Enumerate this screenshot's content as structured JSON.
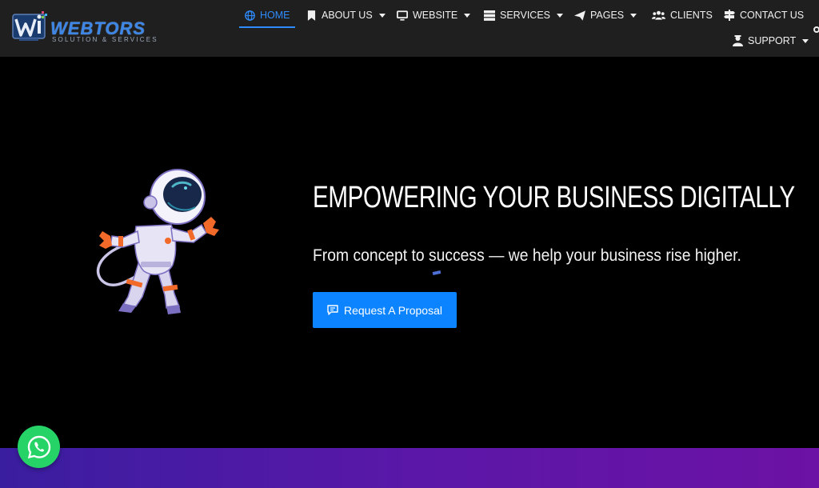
{
  "brand": {
    "name": "WEBTORS",
    "tagline": "SOLUTION & SERVICES",
    "accent": "#3d86e6"
  },
  "nav": {
    "items": [
      {
        "label": "HOME",
        "icon": "globe-icon",
        "dropdown": false,
        "active": true
      },
      {
        "label": "ABOUT US",
        "icon": "bookmark-icon",
        "dropdown": true
      },
      {
        "label": "WEBSITE",
        "icon": "monitor-icon",
        "dropdown": true
      },
      {
        "label": "SERVICES",
        "icon": "server-icon",
        "dropdown": true
      },
      {
        "label": "PAGES",
        "icon": "paper-plane-icon",
        "dropdown": true
      },
      {
        "label": "CLIENTS",
        "icon": "users-icon",
        "dropdown": false
      },
      {
        "label": "CONTACT US",
        "icon": "signpost-icon",
        "dropdown": false
      },
      {
        "label": "SUPPORT",
        "icon": "support-agent-icon",
        "dropdown": true
      }
    ],
    "active_color": "#2f8cff"
  },
  "hero": {
    "title": "EMPOWERING YOUR BUSINESS DIGITALLY",
    "subtitle": "From concept to success — we help your business rise higher.",
    "cta_label": "Request A Proposal",
    "cta_icon": "message-icon",
    "cta_color": "#0d84ff"
  },
  "floating": {
    "whatsapp_icon": "whatsapp-icon",
    "whatsapp_color": "#25d366"
  }
}
